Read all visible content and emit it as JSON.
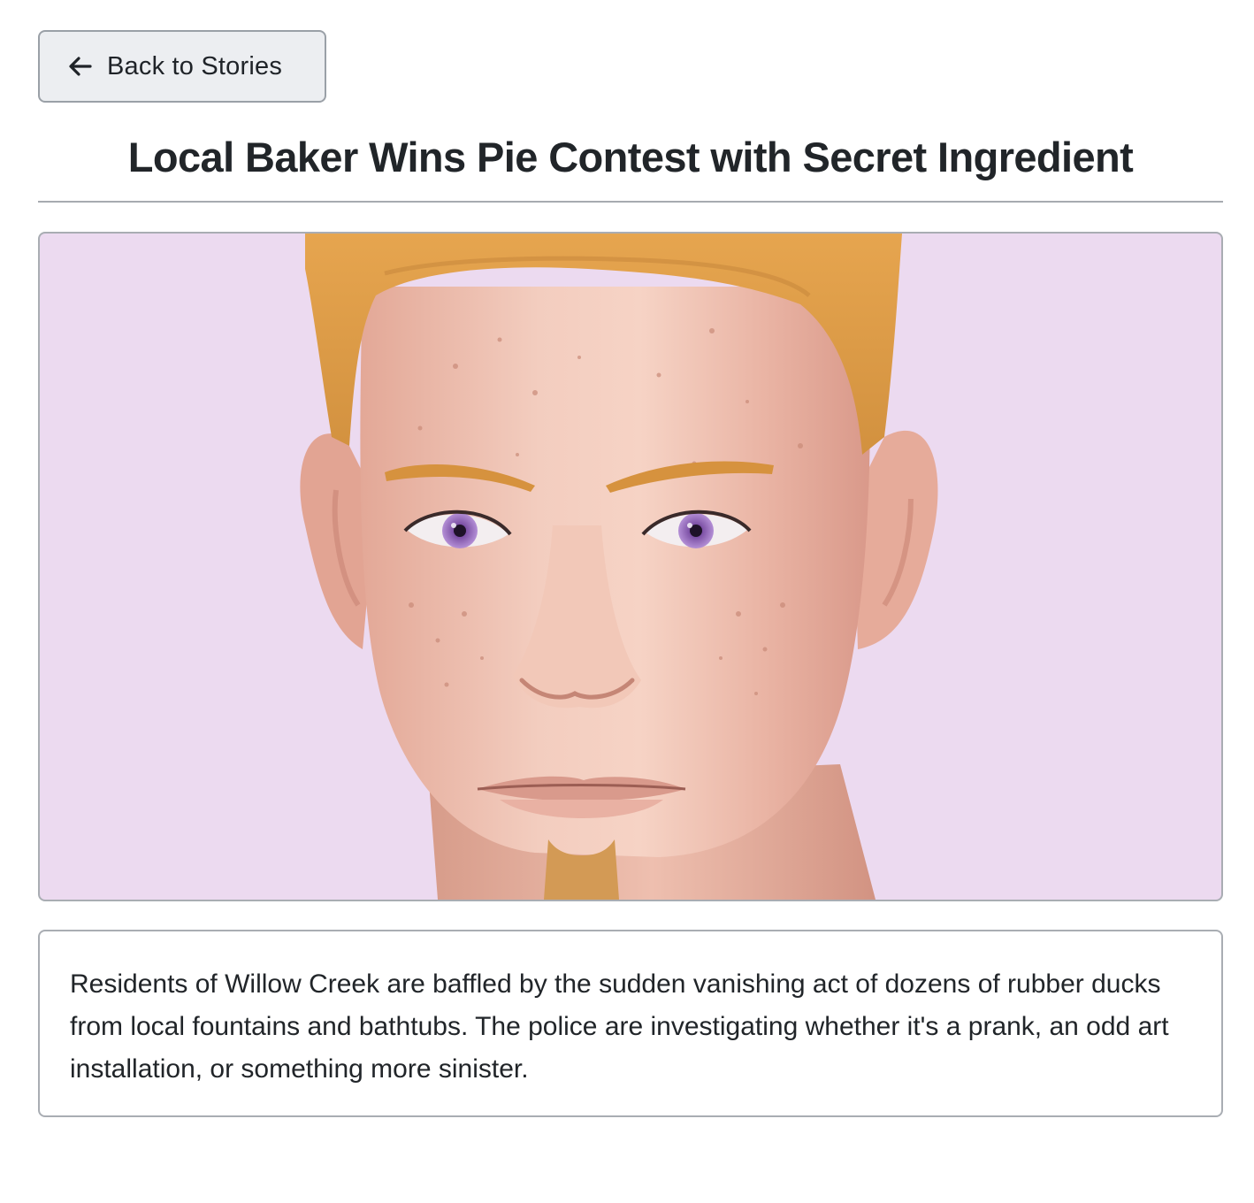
{
  "nav": {
    "back_label": "Back to Stories",
    "back_icon": "arrow-left-icon"
  },
  "article": {
    "title": "Local Baker Wins Pie Contest with Secret Ingredient",
    "body": "Residents of Willow Creek are baffled by the sudden vanishing act of dozens of rubber ducks from local fountains and bathtubs. The police are investigating whether it's a prank, an odd art installation, or something more sinister."
  },
  "colors": {
    "image_background": "#ecdaf0",
    "border": "#a9adb3",
    "button_background": "#eceef1"
  }
}
